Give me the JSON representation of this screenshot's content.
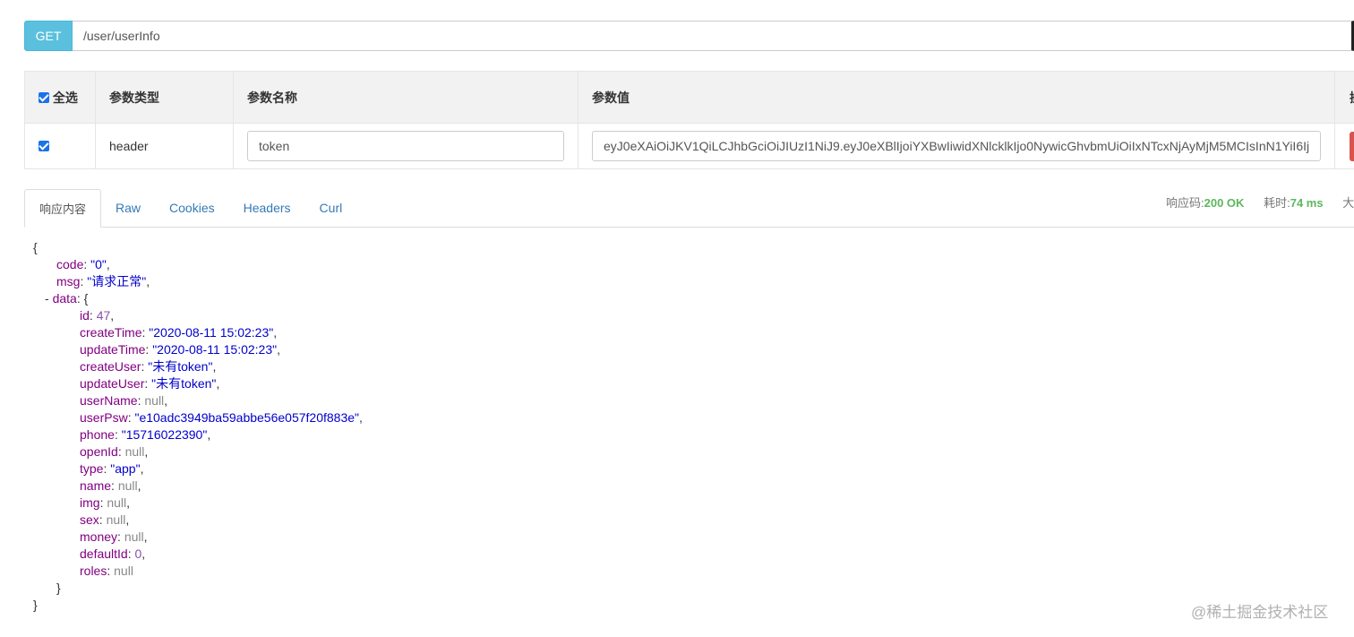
{
  "request": {
    "method": "GET",
    "url": "/user/userInfo"
  },
  "params": {
    "headers": {
      "select_all": "全选",
      "type": "参数类型",
      "name": "参数名称",
      "value": "参数值",
      "action_partial": "操"
    },
    "rows": [
      {
        "type": "header",
        "name": "token",
        "value": "eyJ0eXAiOiJKV1QiLCJhbGciOiJIUzI1NiJ9.eyJ0eXBlIjoiYXBwIiwidXNlcklkIjo0NywicGhvbmUiOiIxNTcxNjAyMjM5MCIsInN1YiI6Ij"
      }
    ]
  },
  "tabs": [
    "响应内容",
    "Raw",
    "Cookies",
    "Headers",
    "Curl"
  ],
  "stats": {
    "code_label": "响应码:",
    "code_value": "200 OK",
    "time_label": "耗时:",
    "time_value": "74 ms",
    "size_label_partial": "大小"
  },
  "response": [
    {
      "ind": 0,
      "parts": [
        [
          "p",
          "{"
        ]
      ]
    },
    {
      "ind": 1,
      "parts": [
        [
          "k",
          "code"
        ],
        [
          "p",
          ": "
        ],
        [
          "s",
          "\"0\""
        ],
        [
          "p",
          ","
        ]
      ]
    },
    {
      "ind": 1,
      "parts": [
        [
          "k",
          "msg"
        ],
        [
          "p",
          ": "
        ],
        [
          "s",
          "\"请求正常\""
        ],
        [
          "p",
          ","
        ]
      ]
    },
    {
      "ind": 0.5,
      "parts": [
        [
          "p",
          "-  "
        ],
        [
          "k",
          "data"
        ],
        [
          "p",
          ": {"
        ]
      ]
    },
    {
      "ind": 2,
      "parts": [
        [
          "k",
          "id"
        ],
        [
          "p",
          ": "
        ],
        [
          "n",
          "47"
        ],
        [
          "p",
          ","
        ]
      ]
    },
    {
      "ind": 2,
      "parts": [
        [
          "k",
          "createTime"
        ],
        [
          "p",
          ": "
        ],
        [
          "s",
          "\"2020-08-11 15:02:23\""
        ],
        [
          "p",
          ","
        ]
      ]
    },
    {
      "ind": 2,
      "parts": [
        [
          "k",
          "updateTime"
        ],
        [
          "p",
          ": "
        ],
        [
          "s",
          "\"2020-08-11 15:02:23\""
        ],
        [
          "p",
          ","
        ]
      ]
    },
    {
      "ind": 2,
      "parts": [
        [
          "k",
          "createUser"
        ],
        [
          "p",
          ": "
        ],
        [
          "s",
          "\"未有token\""
        ],
        [
          "p",
          ","
        ]
      ]
    },
    {
      "ind": 2,
      "parts": [
        [
          "k",
          "updateUser"
        ],
        [
          "p",
          ": "
        ],
        [
          "s",
          "\"未有token\""
        ],
        [
          "p",
          ","
        ]
      ]
    },
    {
      "ind": 2,
      "parts": [
        [
          "k",
          "userName"
        ],
        [
          "p",
          ": "
        ],
        [
          "nl",
          "null"
        ],
        [
          "p",
          ","
        ]
      ]
    },
    {
      "ind": 2,
      "parts": [
        [
          "k",
          "userPsw"
        ],
        [
          "p",
          ": "
        ],
        [
          "s",
          "\"e10adc3949ba59abbe56e057f20f883e\""
        ],
        [
          "p",
          ","
        ]
      ]
    },
    {
      "ind": 2,
      "parts": [
        [
          "k",
          "phone"
        ],
        [
          "p",
          ": "
        ],
        [
          "s",
          "\"15716022390\""
        ],
        [
          "p",
          ","
        ]
      ]
    },
    {
      "ind": 2,
      "parts": [
        [
          "k",
          "openId"
        ],
        [
          "p",
          ": "
        ],
        [
          "nl",
          "null"
        ],
        [
          "p",
          ","
        ]
      ]
    },
    {
      "ind": 2,
      "parts": [
        [
          "k",
          "type"
        ],
        [
          "p",
          ": "
        ],
        [
          "s",
          "\"app\""
        ],
        [
          "p",
          ","
        ]
      ]
    },
    {
      "ind": 2,
      "parts": [
        [
          "k",
          "name"
        ],
        [
          "p",
          ": "
        ],
        [
          "nl",
          "null"
        ],
        [
          "p",
          ","
        ]
      ]
    },
    {
      "ind": 2,
      "parts": [
        [
          "k",
          "img"
        ],
        [
          "p",
          ": "
        ],
        [
          "nl",
          "null"
        ],
        [
          "p",
          ","
        ]
      ]
    },
    {
      "ind": 2,
      "parts": [
        [
          "k",
          "sex"
        ],
        [
          "p",
          ": "
        ],
        [
          "nl",
          "null"
        ],
        [
          "p",
          ","
        ]
      ]
    },
    {
      "ind": 2,
      "parts": [
        [
          "k",
          "money"
        ],
        [
          "p",
          ": "
        ],
        [
          "nl",
          "null"
        ],
        [
          "p",
          ","
        ]
      ]
    },
    {
      "ind": 2,
      "parts": [
        [
          "k",
          "defaultId"
        ],
        [
          "p",
          ": "
        ],
        [
          "n",
          "0"
        ],
        [
          "p",
          ","
        ]
      ]
    },
    {
      "ind": 2,
      "parts": [
        [
          "k",
          "roles"
        ],
        [
          "p",
          ": "
        ],
        [
          "nl",
          "null"
        ]
      ]
    },
    {
      "ind": 1,
      "parts": [
        [
          "p",
          "}"
        ]
      ]
    },
    {
      "ind": 0,
      "parts": [
        [
          "p",
          "}"
        ]
      ]
    }
  ],
  "watermark": "@稀土掘金技术社区"
}
